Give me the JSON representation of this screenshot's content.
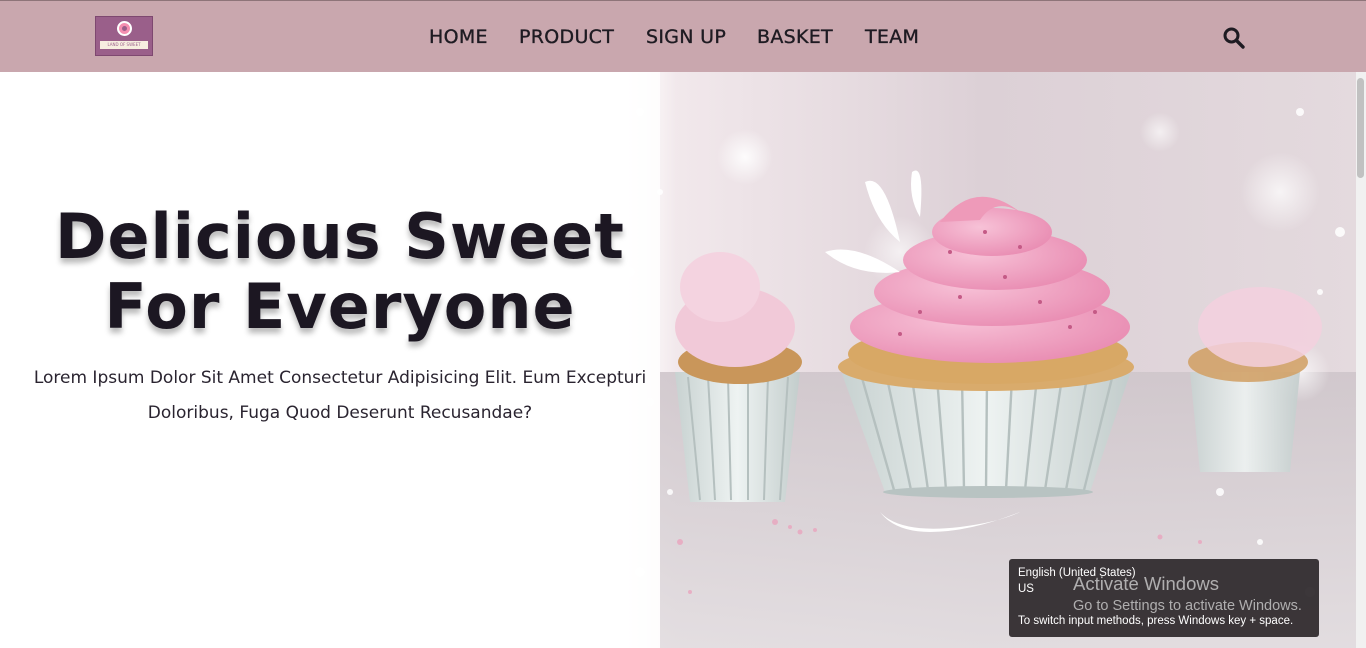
{
  "header": {
    "logo_text": "LAND OF SWEET",
    "nav": [
      {
        "label": "HOME"
      },
      {
        "label": "PRODUCT"
      },
      {
        "label": "SIGN UP"
      },
      {
        "label": "BASKET"
      },
      {
        "label": "TEAM"
      }
    ],
    "search_icon": "search-icon"
  },
  "hero": {
    "headline_line1": "Delicious Sweet",
    "headline_line2": "For Everyone",
    "subtext_line1": "Lorem Ipsum Dolor Sit Amet Consectetur Adipisicing Elit. Eum Excepturi",
    "subtext_line2": "Doloribus, Fuga Quod Deserunt Recusandae?",
    "image": "pink-cupcakes-photo"
  },
  "os": {
    "ime_language": "English (United States)",
    "ime_layout": "US",
    "ime_hint": "To switch input methods, press Windows key + space.",
    "activation_title": "Activate Windows",
    "activation_subtitle": "Go to Settings to activate Windows."
  },
  "colors": {
    "header_bg": "#c9a7ae",
    "text_dark": "#1c1722",
    "frosting_pink": "#f0a6c4",
    "cup_color": "#dfe7e6"
  }
}
